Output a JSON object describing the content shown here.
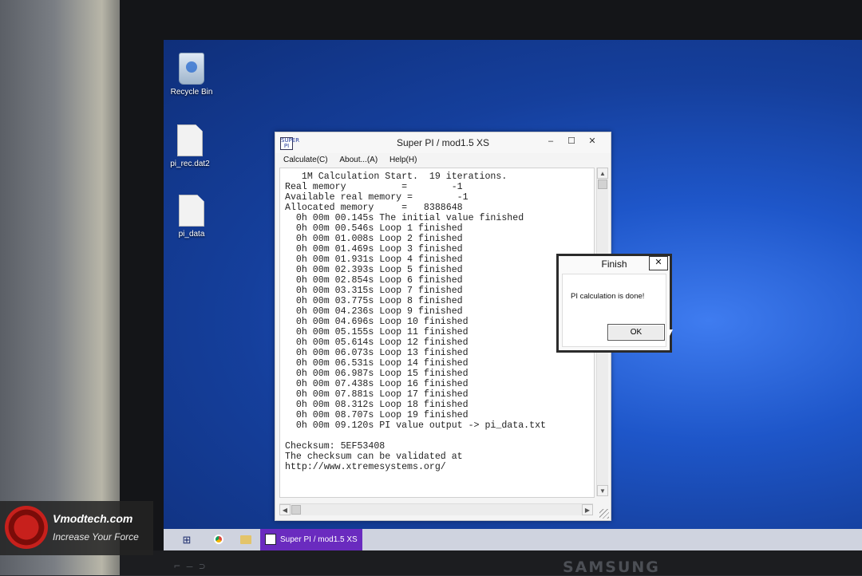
{
  "desktop": {
    "icons": [
      {
        "label": "Recycle Bin"
      },
      {
        "label": "pi_rec.dat2"
      },
      {
        "label": "pi_data"
      }
    ]
  },
  "superpi": {
    "logo_text": "SUPER PI",
    "title": "Super PI / mod1.5 XS",
    "controls": {
      "minimize": "–",
      "maximize": "☐",
      "close": "✕"
    },
    "menu": [
      "Calculate(C)",
      "About...(A)",
      "Help(H)"
    ],
    "log": [
      "   1M Calculation Start.  19 iterations.",
      "Real memory          =        -1",
      "Available real memory =        -1",
      "Allocated memory     =   8388648",
      "  0h 00m 00.145s The initial value finished",
      "  0h 00m 00.546s Loop 1 finished",
      "  0h 00m 01.008s Loop 2 finished",
      "  0h 00m 01.469s Loop 3 finished",
      "  0h 00m 01.931s Loop 4 finished",
      "  0h 00m 02.393s Loop 5 finished",
      "  0h 00m 02.854s Loop 6 finished",
      "  0h 00m 03.315s Loop 7 finished",
      "  0h 00m 03.775s Loop 8 finished",
      "  0h 00m 04.236s Loop 9 finished",
      "  0h 00m 04.696s Loop 10 finished",
      "  0h 00m 05.155s Loop 11 finished",
      "  0h 00m 05.614s Loop 12 finished",
      "  0h 00m 06.073s Loop 13 finished",
      "  0h 00m 06.531s Loop 14 finished",
      "  0h 00m 06.987s Loop 15 finished",
      "  0h 00m 07.438s Loop 16 finished",
      "  0h 00m 07.881s Loop 17 finished",
      "  0h 00m 08.312s Loop 18 finished",
      "  0h 00m 08.707s Loop 19 finished",
      "  0h 00m 09.120s PI value output -> pi_data.txt",
      "",
      "Checksum: 5EF53408",
      "The checksum can be validated at",
      "http://www.xtremesystems.org/"
    ]
  },
  "finish_dialog": {
    "title": "Finish",
    "close": "✕",
    "message": "PI calculation is done!",
    "ok": "OK"
  },
  "taskbar": {
    "start_glyph": "⊞",
    "active_app": "Super PI / mod1.5 XS"
  },
  "monitor": {
    "brand": "SAMSUNG",
    "marks": "⌐ – ⊃"
  },
  "watermark": {
    "name": "Vmodtech.com",
    "tagline": "Increase Your Force"
  }
}
